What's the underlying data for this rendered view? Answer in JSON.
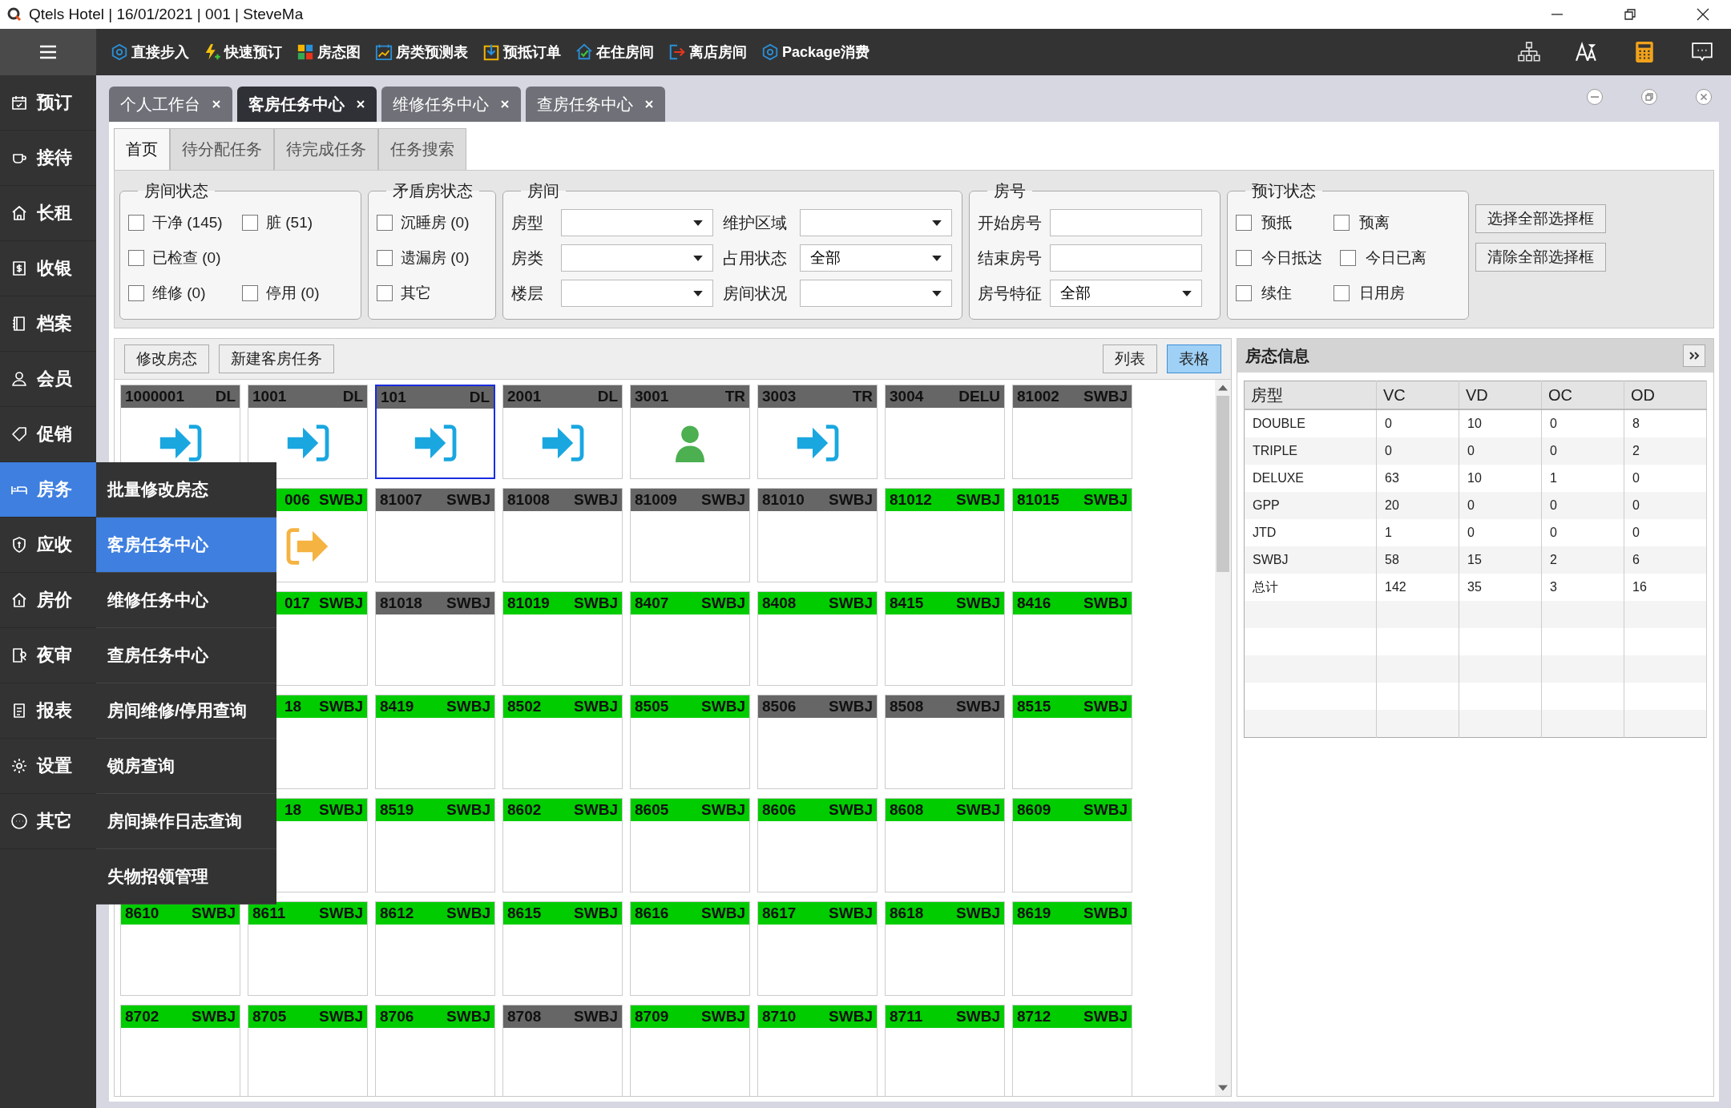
{
  "window": {
    "title": "Qtels Hotel | 16/01/2021 | 001 | SteveMa"
  },
  "toolbar": [
    {
      "label": "直接步入"
    },
    {
      "label": "快速预订"
    },
    {
      "label": "房态图"
    },
    {
      "label": "房类预测表"
    },
    {
      "label": "预抵订单"
    },
    {
      "label": "在住房间"
    },
    {
      "label": "离店房间"
    },
    {
      "label": "Package消费"
    }
  ],
  "sidebar": {
    "items": [
      {
        "label": "预订",
        "selected": false
      },
      {
        "label": "接待",
        "selected": false
      },
      {
        "label": "长租",
        "selected": false
      },
      {
        "label": "收银",
        "selected": false
      },
      {
        "label": "档案",
        "selected": false
      },
      {
        "label": "会员",
        "selected": false
      },
      {
        "label": "促销",
        "selected": false
      },
      {
        "label": "房务",
        "selected": true
      },
      {
        "label": "应收",
        "selected": false
      },
      {
        "label": "房价",
        "selected": false
      },
      {
        "label": "夜审",
        "selected": false
      },
      {
        "label": "报表",
        "selected": false
      },
      {
        "label": "设置",
        "selected": false
      },
      {
        "label": "其它",
        "selected": false
      }
    ]
  },
  "popup_menu": [
    {
      "label": "批量修改房态",
      "selected": false
    },
    {
      "label": "客房任务中心",
      "selected": true
    },
    {
      "label": "维修任务中心",
      "selected": false
    },
    {
      "label": "查房任务中心",
      "selected": false
    },
    {
      "label": "房间维修/停用查询",
      "selected": false
    },
    {
      "label": "锁房查询",
      "selected": false
    },
    {
      "label": "房间操作日志查询",
      "selected": false
    },
    {
      "label": "失物招领管理",
      "selected": false
    }
  ],
  "tabs": [
    {
      "label": "个人工作台",
      "selected": false
    },
    {
      "label": "客房任务中心",
      "selected": true
    },
    {
      "label": "维修任务中心",
      "selected": false
    },
    {
      "label": "查房任务中心",
      "selected": false
    }
  ],
  "sub_tabs": [
    {
      "label": "首页",
      "selected": true
    },
    {
      "label": "待分配任务",
      "selected": false
    },
    {
      "label": "待完成任务",
      "selected": false
    },
    {
      "label": "任务搜索",
      "selected": false
    }
  ],
  "room_status": {
    "title": "房间状态",
    "rows": [
      [
        {
          "label": "干净 (145)",
          "checked": false
        },
        {
          "label": "脏 (51)",
          "checked": false
        }
      ],
      [
        {
          "label": "已检查 (0)",
          "checked": false
        }
      ],
      [
        {
          "label": "维修 (0)",
          "checked": false
        },
        {
          "label": "停用 (0)",
          "checked": false
        }
      ]
    ]
  },
  "conflict_status": {
    "title": "矛盾房状态",
    "rows": [
      [
        {
          "label": "沉睡房 (0)",
          "checked": false
        }
      ],
      [
        {
          "label": "遗漏房 (0)",
          "checked": false
        }
      ],
      [
        {
          "label": "其它",
          "checked": false
        }
      ]
    ]
  },
  "room": {
    "title": "房间",
    "rows": [
      [
        {
          "label": "房型"
        },
        {
          "label": "维护区域"
        }
      ],
      [
        {
          "label": "房类"
        },
        {
          "label": "占用状态",
          "value": "全部"
        }
      ],
      [
        {
          "label": "楼层"
        },
        {
          "label": "房间状况"
        }
      ]
    ]
  },
  "room_number": {
    "title": "房号",
    "fields": [
      {
        "label": "开始房号",
        "kind": "input"
      },
      {
        "label": "结束房号",
        "kind": "input"
      },
      {
        "label": "房号特征",
        "kind": "dropdown",
        "value": "全部"
      }
    ]
  },
  "booking_status": {
    "title": "预订状态",
    "rows": [
      [
        {
          "label": "预抵",
          "checked": false
        },
        {
          "label": "预离",
          "checked": false
        }
      ],
      [
        {
          "label": "今日抵达",
          "checked": false
        },
        {
          "label": "今日已离",
          "checked": false
        }
      ],
      [
        {
          "label": "续住",
          "checked": false
        },
        {
          "label": "日用房",
          "checked": false
        }
      ]
    ]
  },
  "filter_buttons": [
    "选择全部选择框",
    "清除全部选择框"
  ],
  "grid_actions": [
    "修改房态",
    "新建客房任务"
  ],
  "view_toggle": [
    {
      "label": "列表",
      "selected": false
    },
    {
      "label": "表格",
      "selected": true
    }
  ],
  "rooms": [
    [
      {
        "kind": "room",
        "number": "1000001",
        "type": "DL",
        "color": "#666666",
        "selected": false
      },
      {
        "kind": "room",
        "number": "1001",
        "type": "DL",
        "color": "#666666",
        "selected": false
      },
      {
        "kind": "room",
        "number": "101",
        "type": "DL",
        "color": "#666666",
        "selected": true
      },
      {
        "kind": "room",
        "number": "2001",
        "type": "DL",
        "color": "#666666",
        "selected": false
      },
      {
        "kind": "room",
        "number": "3001",
        "type": "TR",
        "color": "#666666",
        "selected": false
      },
      {
        "kind": "room",
        "number": "3003",
        "type": "TR",
        "color": "#666666",
        "selected": false
      },
      {
        "kind": "room",
        "number": "3004",
        "type": "DELU",
        "color": "#666666",
        "selected": false
      },
      {
        "kind": "room",
        "number": "81002",
        "type": "SWBJ",
        "color": "#666666",
        "selected": false
      }
    ],
    [
      {
        "kind": "hidden"
      },
      {
        "kind": "cut",
        "number": "006",
        "type": "SWBJ",
        "color": "#00cc00",
        "selected": false
      },
      {
        "kind": "room",
        "number": "81007",
        "type": "SWBJ",
        "color": "#666666",
        "selected": false
      },
      {
        "kind": "room",
        "number": "81008",
        "type": "SWBJ",
        "color": "#666666",
        "selected": false
      },
      {
        "kind": "room",
        "number": "81009",
        "type": "SWBJ",
        "color": "#666666",
        "selected": false
      },
      {
        "kind": "room",
        "number": "81010",
        "type": "SWBJ",
        "color": "#666666",
        "selected": false
      },
      {
        "kind": "room",
        "number": "81012",
        "type": "SWBJ",
        "color": "#00cc00",
        "selected": false
      },
      {
        "kind": "room",
        "number": "81015",
        "type": "SWBJ",
        "color": "#00cc00",
        "selected": false
      }
    ],
    [
      {
        "kind": "hidden"
      },
      {
        "kind": "cut",
        "number": "017",
        "type": "SWBJ",
        "color": "#00cc00",
        "selected": false
      },
      {
        "kind": "room",
        "number": "81018",
        "type": "SWBJ",
        "color": "#666666",
        "selected": false
      },
      {
        "kind": "room",
        "number": "81019",
        "type": "SWBJ",
        "color": "#00cc00",
        "selected": false
      },
      {
        "kind": "room",
        "number": "8407",
        "type": "SWBJ",
        "color": "#00cc00",
        "selected": false
      },
      {
        "kind": "room",
        "number": "8408",
        "type": "SWBJ",
        "color": "#00cc00",
        "selected": false
      },
      {
        "kind": "room",
        "number": "8415",
        "type": "SWBJ",
        "color": "#00cc00",
        "selected": false
      },
      {
        "kind": "room",
        "number": "8416",
        "type": "SWBJ",
        "color": "#00cc00",
        "selected": false
      }
    ],
    [
      {
        "kind": "hidden"
      },
      {
        "kind": "cut",
        "number": "18",
        "type": "SWBJ",
        "color": "#00cc00",
        "selected": false
      },
      {
        "kind": "room",
        "number": "8419",
        "type": "SWBJ",
        "color": "#00cc00",
        "selected": false
      },
      {
        "kind": "room",
        "number": "8502",
        "type": "SWBJ",
        "color": "#00cc00",
        "selected": false
      },
      {
        "kind": "room",
        "number": "8505",
        "type": "SWBJ",
        "color": "#00cc00",
        "selected": false
      },
      {
        "kind": "room",
        "number": "8506",
        "type": "SWBJ",
        "color": "#666666",
        "selected": false
      },
      {
        "kind": "room",
        "number": "8508",
        "type": "SWBJ",
        "color": "#666666",
        "selected": false
      },
      {
        "kind": "room",
        "number": "8515",
        "type": "SWBJ",
        "color": "#00cc00",
        "selected": false
      }
    ],
    [
      {
        "kind": "hidden"
      },
      {
        "kind": "cut",
        "number": "18",
        "type": "SWBJ",
        "color": "#00cc00",
        "selected": false
      },
      {
        "kind": "room",
        "number": "8519",
        "type": "SWBJ",
        "color": "#00cc00",
        "selected": false
      },
      {
        "kind": "room",
        "number": "8602",
        "type": "SWBJ",
        "color": "#00cc00",
        "selected": false
      },
      {
        "kind": "room",
        "number": "8605",
        "type": "SWBJ",
        "color": "#00cc00",
        "selected": false
      },
      {
        "kind": "room",
        "number": "8606",
        "type": "SWBJ",
        "color": "#00cc00",
        "selected": false
      },
      {
        "kind": "room",
        "number": "8608",
        "type": "SWBJ",
        "color": "#00cc00",
        "selected": false
      },
      {
        "kind": "room",
        "number": "8609",
        "type": "SWBJ",
        "color": "#00cc00",
        "selected": false
      }
    ],
    [
      {
        "kind": "room",
        "number": "8610",
        "type": "SWBJ",
        "color": "#00cc00",
        "selected": false
      },
      {
        "kind": "room",
        "number": "8611",
        "type": "SWBJ",
        "color": "#00cc00",
        "selected": false
      },
      {
        "kind": "room",
        "number": "8612",
        "type": "SWBJ",
        "color": "#00cc00",
        "selected": false
      },
      {
        "kind": "room",
        "number": "8615",
        "type": "SWBJ",
        "color": "#00cc00",
        "selected": false
      },
      {
        "kind": "room",
        "number": "8616",
        "type": "SWBJ",
        "color": "#00cc00",
        "selected": false
      },
      {
        "kind": "room",
        "number": "8617",
        "type": "SWBJ",
        "color": "#00cc00",
        "selected": false
      },
      {
        "kind": "room",
        "number": "8618",
        "type": "SWBJ",
        "color": "#00cc00",
        "selected": false
      },
      {
        "kind": "room",
        "number": "8619",
        "type": "SWBJ",
        "color": "#00cc00",
        "selected": false
      }
    ],
    [
      {
        "kind": "room",
        "number": "8702",
        "type": "SWBJ",
        "color": "#00cc00",
        "selected": false
      },
      {
        "kind": "room",
        "number": "8705",
        "type": "SWBJ",
        "color": "#00cc00",
        "selected": false
      },
      {
        "kind": "room",
        "number": "8706",
        "type": "SWBJ",
        "color": "#00cc00",
        "selected": false
      },
      {
        "kind": "room",
        "number": "8708",
        "type": "SWBJ",
        "color": "#666666",
        "selected": false
      },
      {
        "kind": "room",
        "number": "8709",
        "type": "SWBJ",
        "color": "#00cc00",
        "selected": false
      },
      {
        "kind": "room",
        "number": "8710",
        "type": "SWBJ",
        "color": "#00cc00",
        "selected": false
      },
      {
        "kind": "room",
        "number": "8711",
        "type": "SWBJ",
        "color": "#00cc00",
        "selected": false
      },
      {
        "kind": "room",
        "number": "8712",
        "type": "SWBJ",
        "color": "#00cc00",
        "selected": false
      }
    ]
  ],
  "room_info": {
    "title": "房态信息",
    "columns": [
      "房型",
      "VC",
      "VD",
      "OC",
      "OD"
    ],
    "rows": [
      [
        "DOUBLE",
        "0",
        "10",
        "0",
        "8"
      ],
      [
        "TRIPLE",
        "0",
        "0",
        "0",
        "2"
      ],
      [
        "DELUXE",
        "63",
        "10",
        "1",
        "0"
      ],
      [
        "GPP",
        "20",
        "0",
        "0",
        "0"
      ],
      [
        "JTD",
        "1",
        "0",
        "0",
        "0"
      ],
      [
        "SWBJ",
        "58",
        "15",
        "2",
        "6"
      ],
      [
        "总计",
        "142",
        "35",
        "3",
        "16"
      ]
    ]
  }
}
